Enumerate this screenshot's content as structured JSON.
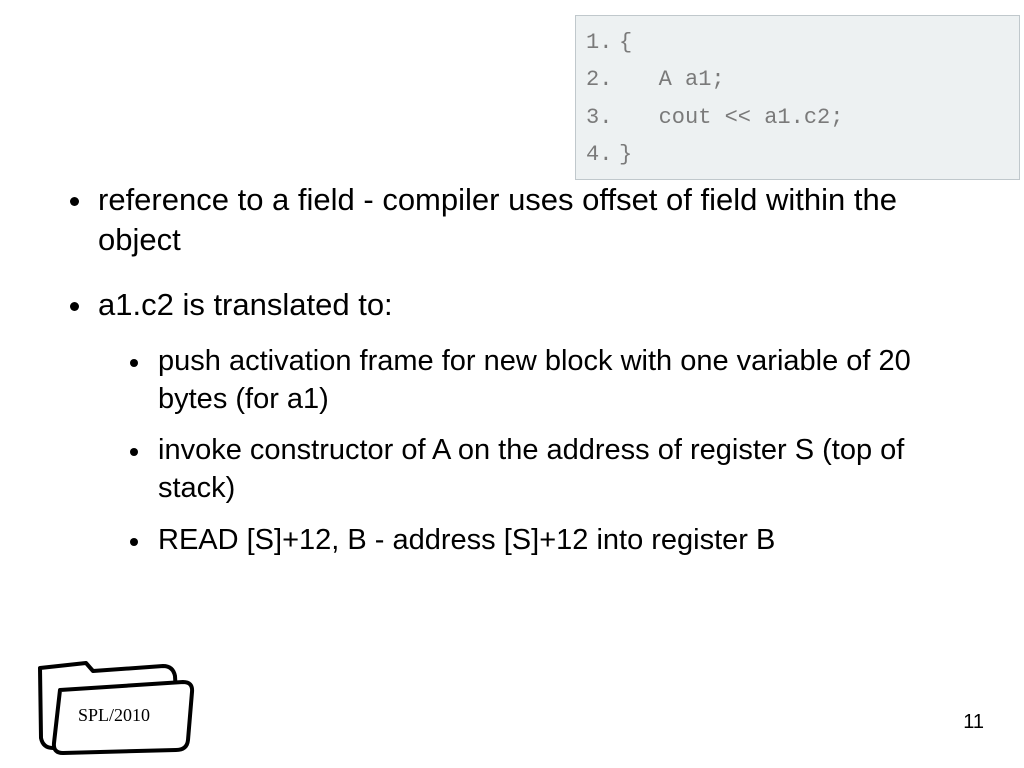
{
  "code": {
    "lines": [
      {
        "n": "1.",
        "t": "{"
      },
      {
        "n": "2.",
        "t": "   A a1;"
      },
      {
        "n": "3.",
        "t": "   cout << a1.c2;"
      },
      {
        "n": "4.",
        "t": "}"
      }
    ]
  },
  "bullets": {
    "b1": "reference to a field - compiler uses offset of field within the object",
    "b2": "a1.c2 is translated to:",
    "sub1": "push activation frame for new block with one variable of 20 bytes (for a1)",
    "sub2": "invoke constructor of A on the address of register S (top of stack)",
    "sub3": " READ [S]+12, B - address [S]+12 into register B"
  },
  "footer": {
    "label": "SPL/2010",
    "page": "11"
  }
}
